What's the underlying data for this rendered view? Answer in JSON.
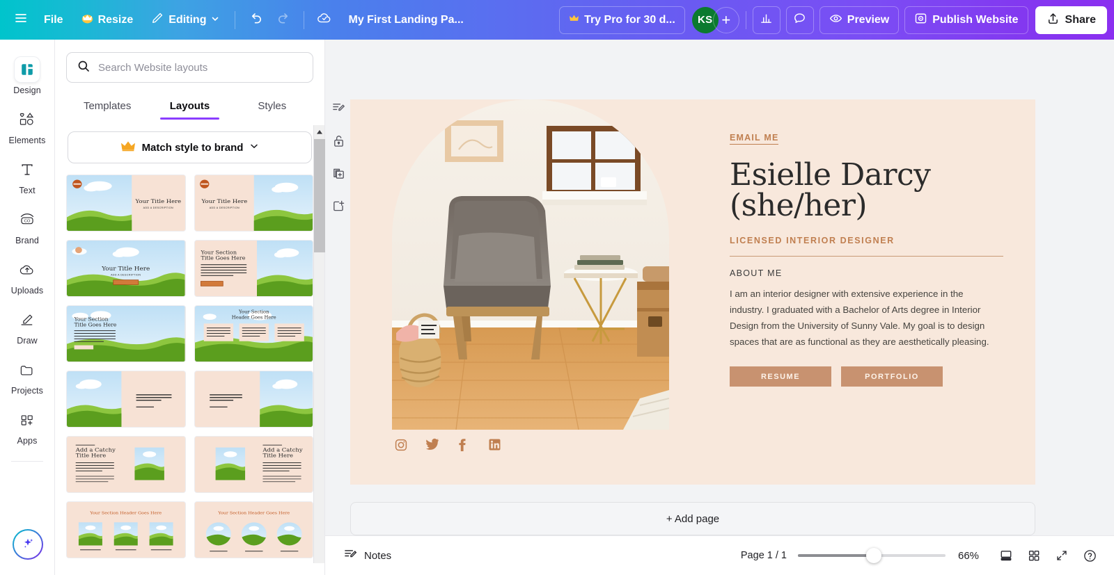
{
  "topbar": {
    "menu_icon": "hamburger-icon",
    "file_label": "File",
    "resize_label": "Resize",
    "editing_label": "Editing",
    "undo_icon": "undo-icon",
    "redo_icon": "redo-icon",
    "cloud_icon": "cloud-saved-icon",
    "doc_title": "My First Landing Pa...",
    "try_pro_label": "Try Pro for 30 d...",
    "avatar_initials": "KS",
    "add_collaborator": "+",
    "insights_icon": "bar-chart-icon",
    "comment_icon": "comment-icon",
    "preview_label": "Preview",
    "publish_label": "Publish Website",
    "share_label": "Share"
  },
  "rail": {
    "items": [
      {
        "label": "Design",
        "icon": "design-icon"
      },
      {
        "label": "Elements",
        "icon": "elements-icon"
      },
      {
        "label": "Text",
        "icon": "text-icon"
      },
      {
        "label": "Brand",
        "icon": "brand-icon"
      },
      {
        "label": "Uploads",
        "icon": "uploads-icon"
      },
      {
        "label": "Draw",
        "icon": "draw-icon"
      },
      {
        "label": "Projects",
        "icon": "projects-icon"
      },
      {
        "label": "Apps",
        "icon": "apps-icon"
      }
    ],
    "magic_icon": "magic-sparkle-icon"
  },
  "panel": {
    "search_placeholder": "Search Website layouts",
    "search_value": "",
    "search_icon": "search-icon",
    "tabs": [
      {
        "label": "Templates",
        "active": false
      },
      {
        "label": "Layouts",
        "active": true
      },
      {
        "label": "Styles",
        "active": false
      }
    ],
    "match_style_label": "Match style to brand",
    "match_style_icon": "crown-icon",
    "match_style_chevron": "chevron-down-icon",
    "thumbs": [
      {
        "id": "layout-1",
        "type": "split-right-text",
        "title": "Your Title Here",
        "sub": "ADD A DESCRIPTION"
      },
      {
        "id": "layout-2",
        "type": "split-left-text",
        "title": "Your Title Here",
        "sub": "ADD A DESCRIPTION"
      },
      {
        "id": "layout-3",
        "type": "full-center",
        "title": "Your Title Here",
        "sub": "ADD A DESCRIPTION"
      },
      {
        "id": "layout-4",
        "type": "section-left",
        "title": "Your Section Title Goes Here",
        "sub": ""
      },
      {
        "id": "layout-5",
        "type": "section-overlay",
        "title": "Your Section Title Goes Here",
        "sub": ""
      },
      {
        "id": "layout-6",
        "type": "three-cards",
        "title": "Your Section Header Goes Here",
        "sub": ""
      },
      {
        "id": "layout-7",
        "type": "text-right-block",
        "title": "THIS TEXT ACCOMPANIES THE PHOTO ON THE LEFT. ADD A SHORT CAPTION.",
        "sub": ""
      },
      {
        "id": "layout-8",
        "type": "text-left-block",
        "title": "THIS TEXT ACCOMPANIES THE PHOTO ON THE RIGHT. ADD A SHORT CAPTION.",
        "sub": ""
      },
      {
        "id": "layout-9",
        "type": "catchy-left",
        "title": "Add a Catchy Title Here",
        "sub": ""
      },
      {
        "id": "layout-10",
        "type": "catchy-right",
        "title": "Add a Catchy Title Here",
        "sub": ""
      },
      {
        "id": "layout-11",
        "type": "three-squares",
        "title": "Your Section Header Goes Here",
        "sub": ""
      },
      {
        "id": "layout-12",
        "type": "three-circles",
        "title": "Your Section Header Goes Here",
        "sub": ""
      }
    ],
    "scroll_up_icon": "scroll-up-arrow-icon"
  },
  "float_tools": [
    {
      "icon": "notes-edit-icon"
    },
    {
      "icon": "lock-icon"
    },
    {
      "icon": "duplicate-page-icon"
    },
    {
      "icon": "add-page-icon"
    }
  ],
  "design": {
    "email_me": "EMAIL ME",
    "name_line1": "Esielle Darcy",
    "name_line2": "(she/her)",
    "role": "LICENSED INTERIOR DESIGNER",
    "about_label": "ABOUT ME",
    "about_text": "I am an interior designer with extensive experience in the industry. I graduated with a Bachelor of Arts degree in Interior Design from the University of Sunny Vale. My goal is to design spaces that are as functional as they are aesthetically pleasing.",
    "cta_primary": "RESUME",
    "cta_secondary": "PORTFOLIO",
    "socials": [
      {
        "name": "instagram-icon"
      },
      {
        "name": "twitter-icon"
      },
      {
        "name": "facebook-icon"
      },
      {
        "name": "linkedin-icon"
      }
    ],
    "photo_alt": "interior-room-photo",
    "colors": {
      "page_bg": "#f8e8dc",
      "accent": "#c07f50",
      "button": "#c89270",
      "heading": "#2b2b2b"
    }
  },
  "canvas": {
    "add_page_label": "+ Add page"
  },
  "bottombar": {
    "notes_label": "Notes",
    "notes_icon": "notes-icon",
    "page_indicator": "Page 1 / 1",
    "zoom_value": "66%",
    "zoom_percent": 66,
    "view_icon": "page-view-icon",
    "grid_icon": "grid-view-icon",
    "fullscreen_icon": "fullscreen-icon",
    "help_icon": "help-icon"
  }
}
